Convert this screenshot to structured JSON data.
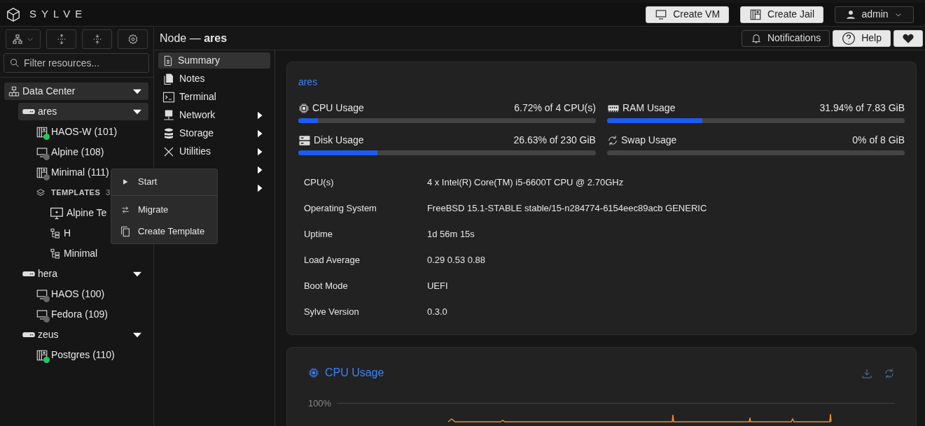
{
  "header": {
    "brand": "SYLVE",
    "buttons": [
      {
        "kind": "vm",
        "label": "Create VM"
      },
      {
        "kind": "jail",
        "label": "Create Jail"
      }
    ],
    "user": {
      "label": "admin"
    }
  },
  "sidebar": {
    "search": {
      "placeholder": "Filter resources..."
    },
    "tree": [
      {
        "kind": "datacenter",
        "label": "Data Center",
        "selected": true,
        "expanded": true,
        "children": [
          {
            "kind": "node",
            "label": "ares",
            "selected": true,
            "expanded": true,
            "children": [
              {
                "kind": "jail",
                "label": "HAOS-W (101)",
                "selected": false,
                "running": true
              },
              {
                "kind": "vm",
                "label": "Alpine (108)",
                "selected": false,
                "running": false
              },
              {
                "kind": "jail",
                "label": "Minimal (111)",
                "selected": false,
                "running": false
              },
              {
                "kind": "group",
                "label": "TEMPLATES",
                "count": "3",
                "selected": false,
                "children": [
                  {
                    "kind": "vmtemplate",
                    "label": "Alpine Te",
                    "selected": false
                  },
                  {
                    "kind": "jailtemplate",
                    "label": "H",
                    "selected": false
                  },
                  {
                    "kind": "jailtemplate",
                    "label": "Minimal",
                    "selected": false
                  }
                ]
              }
            ]
          },
          {
            "kind": "node",
            "label": "hera",
            "selected": false,
            "expanded": true,
            "children": [
              {
                "kind": "vm",
                "label": "HAOS (100)",
                "selected": false,
                "running": false
              },
              {
                "kind": "vm",
                "label": "Fedora (109)",
                "selected": false,
                "running": false
              }
            ]
          },
          {
            "kind": "node",
            "label": "zeus",
            "selected": false,
            "expanded": true,
            "children": [
              {
                "kind": "jail",
                "label": "Postgres (110)",
                "selected": false,
                "running": true
              }
            ]
          }
        ]
      }
    ]
  },
  "context_menu": [
    {
      "kind": "play",
      "label": "Start"
    },
    {
      "kind": "divider"
    },
    {
      "kind": "swap",
      "label": "Migrate"
    },
    {
      "kind": "copy",
      "label": "Create Template"
    }
  ],
  "page_title": {
    "prefix": "Node — ",
    "name": "ares"
  },
  "top_actions": [
    {
      "kind": "bell",
      "label": "Notifications"
    },
    {
      "kind": "help",
      "label": "Help"
    },
    {
      "kind": "heart"
    }
  ],
  "nav": [
    {
      "kind": "summary",
      "label": "Summary",
      "selected": true,
      "has_submenu": false
    },
    {
      "kind": "notes",
      "label": "Notes",
      "selected": false,
      "has_submenu": false
    },
    {
      "kind": "terminal",
      "label": "Terminal",
      "selected": false,
      "has_submenu": false
    },
    {
      "kind": "network",
      "label": "Network",
      "selected": false,
      "has_submenu": true
    },
    {
      "kind": "storage",
      "label": "Storage",
      "selected": false,
      "has_submenu": true
    },
    {
      "kind": "utilities",
      "label": "Utilities",
      "selected": false,
      "has_submenu": true
    },
    {
      "kind": "hidden",
      "selected": false,
      "has_submenu": true
    },
    {
      "kind": "hidden",
      "selected": false,
      "has_submenu": true
    }
  ],
  "summary": {
    "title": "ares",
    "meters": [
      {
        "kind": "cpu",
        "name": "CPU Usage",
        "reading": "6.72% of 4 CPU(s)",
        "level": 0.0672
      },
      {
        "kind": "ram",
        "name": "RAM Usage",
        "reading": "31.94% of 7.83 GiB",
        "level": 0.3194
      },
      {
        "kind": "disk",
        "name": "Disk Usage",
        "reading": "26.63% of 230 GiB",
        "level": 0.2663
      },
      {
        "kind": "swap",
        "name": "Swap Usage",
        "reading": "0% of 8 GiB",
        "level": 0
      }
    ],
    "rows": [
      {
        "label": "CPU(s)",
        "value": "4 x Intel(R) Core(TM) i5-6600T CPU @ 2.70GHz"
      },
      {
        "label": "Operating System",
        "value": "FreeBSD 15.1-STABLE stable/15-n284774-6154eec89acb GENERIC"
      },
      {
        "label": "Uptime",
        "value": "1d 56m 15s"
      },
      {
        "label": "Load Average",
        "value": "0.29 0.53 0.88"
      },
      {
        "label": "Boot Mode",
        "value": "UEFI"
      },
      {
        "label": "Sylve Version",
        "value": "0.3.0"
      }
    ]
  },
  "cpu_chart": {
    "title": "CPU Usage",
    "y_tick_label": "100%"
  }
}
